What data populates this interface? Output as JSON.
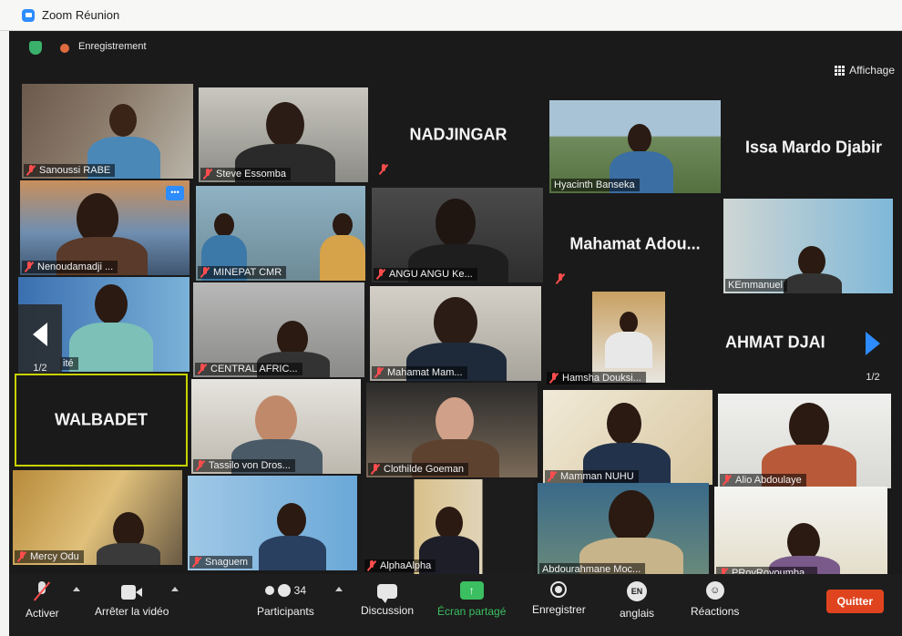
{
  "window": {
    "title": "Zoom Réunion"
  },
  "topbar": {
    "recording_label": "Enregistrement",
    "view_label": "Affichage"
  },
  "participants": {
    "sanoussi": "Sanoussi RABE",
    "steve": "Steve Essomba",
    "nadjingar": "NADJINGAR",
    "hyacinth": "Hyacinth Banseka",
    "issa": "Issa Mardo Djabir",
    "nenoudamadji": "Nenoudamadji ...",
    "minepat": "MINEPAT CMR",
    "angu": "ANGU ANGU Ke...",
    "mahamat_adou": "Mahamat Adou...",
    "kemmanuel": "KEmmanuel",
    "partial": "ité",
    "central": "CENTRAL AFRIC...",
    "mahamat_mam": "Mahamat Mam...",
    "hamsha": "Hamsha Douksi...",
    "ahmat": "AHMAT DJAI",
    "walbadet": "WALBADET",
    "tassilo": "Tassilo von Dros...",
    "clothilde": "Clothilde Goeman",
    "mamman": "Mamman NUHU",
    "alio": "Alio Abdoulaye",
    "mercy": "Mercy Odu",
    "snaguem": "Snaguem",
    "alphaalpha": "AlphaAlpha",
    "abdourahmane": "Abdourahmane Moc...",
    "proy": "PRoyRoyoumba..."
  },
  "pager": {
    "left": "1/2",
    "right": "1/2"
  },
  "toolbar": {
    "activate": "Activer",
    "stop_video": "Arrêter la vidéo",
    "participants_count": "34",
    "participants": "Participants",
    "discussion": "Discussion",
    "share": "Écran partagé",
    "record": "Enregistrer",
    "language_code": "EN",
    "language": "anglais",
    "reactions": "Réactions",
    "quit": "Quitter"
  },
  "colors": {
    "accent": "#2d8cff",
    "share": "#3bbf60",
    "quit": "#e0441f",
    "muted": "#ff4d4d",
    "active_speaker": "#c8d200"
  }
}
